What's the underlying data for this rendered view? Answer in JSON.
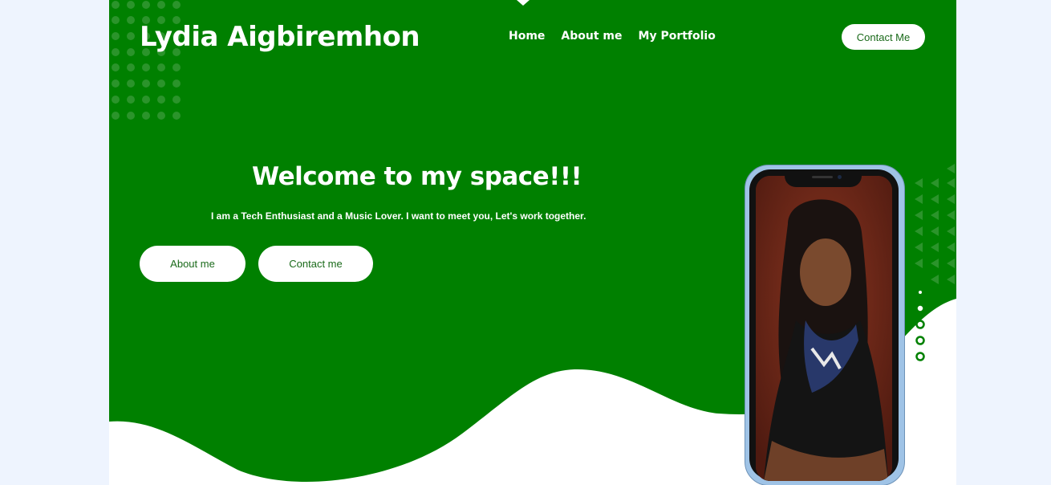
{
  "header": {
    "brand": "Lydia Aigbiremhon",
    "nav": [
      "Home",
      "About me",
      "My Portfolio"
    ],
    "contact_button": "Contact Me"
  },
  "hero": {
    "title": "Welcome to my space!!!",
    "subtitle": "I am a Tech Enthusiast and a Music Lover. I want to meet you, Let's work together.",
    "buttons": {
      "about": "About me",
      "contact": "Contact me"
    }
  },
  "icons": {
    "phone": "phone-mockup-icon",
    "dots": "dot-pattern-icon",
    "triangles": "triangle-pattern-icon"
  },
  "colors": {
    "brand_green": "#008000",
    "background": "#eef4fe",
    "button_text": "#1a6a1a"
  }
}
